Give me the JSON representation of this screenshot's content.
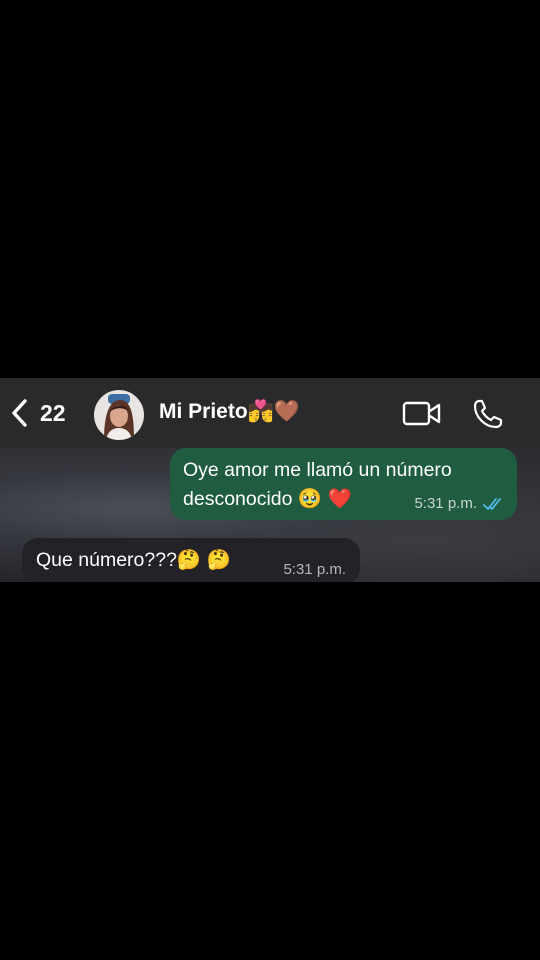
{
  "header": {
    "back_count": "22",
    "contact_name": "Mi Prieto💏🤎"
  },
  "messages": [
    {
      "direction": "outgoing",
      "text": "Oye amor me llamó un número desconocido 🥹 ❤️",
      "time": "5:31 p.m.",
      "status": "read"
    },
    {
      "direction": "incoming",
      "text": "Que número???🤔 🤔",
      "time": "5:31 p.m."
    }
  ],
  "colors": {
    "outgoing_bubble": "#1f5c40",
    "incoming_bubble": "#232327",
    "header_bg": "#2a2a2c",
    "read_ticks": "#53bdeb"
  },
  "icons": {
    "back": "chevron-left-icon",
    "video": "video-camera-icon",
    "call": "phone-icon",
    "read": "double-check-icon"
  }
}
